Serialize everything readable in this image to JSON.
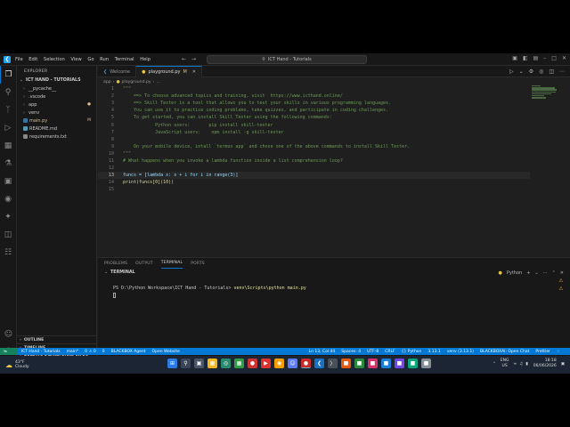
{
  "titlebar": {
    "menu": [
      "File",
      "Edit",
      "Selection",
      "View",
      "Go",
      "Run",
      "Terminal",
      "Help"
    ],
    "search_text": "ICT Hand - Tutorials"
  },
  "sidebar": {
    "header": "EXPLORER",
    "section": "ICT HAND - TUTORIALS",
    "items": [
      {
        "label": "__pycache__",
        "type": "folder",
        "badge": ""
      },
      {
        "label": ".vscode",
        "type": "folder",
        "badge": ""
      },
      {
        "label": "app",
        "type": "folder",
        "badge": "●"
      },
      {
        "label": "venv",
        "type": "folder",
        "badge": ""
      },
      {
        "label": "main.py",
        "type": "py",
        "badge": "M"
      },
      {
        "label": "README.md",
        "type": "md",
        "badge": ""
      },
      {
        "label": "requirements.txt",
        "type": "txt",
        "badge": ""
      }
    ],
    "outline": "OUTLINE",
    "timeline": "TIMELINE",
    "remote": "REMOTE KNOWLEDGE FILES"
  },
  "tabs": [
    {
      "label": "Welcome",
      "active": false,
      "modified": ""
    },
    {
      "label": "playground.py",
      "active": true,
      "modified": "M"
    }
  ],
  "breadcrumb": {
    "folder": "app",
    "file": "playground.py",
    "more": "..."
  },
  "editor": {
    "lines": [
      {
        "n": "1",
        "text": "\"\"\""
      },
      {
        "n": "2",
        "text": "    ==> To choose advanced topics and training, visit  https://www.icthand.online/"
      },
      {
        "n": "3",
        "text": "    ==> Skill Tester is a tool that allows you to test your skills in various programming languages."
      },
      {
        "n": "4",
        "text": "    You can use it to practice coding problems, take quizzes, and participate in coding challenges."
      },
      {
        "n": "5",
        "text": "    To get started, you can install Skill Tester using the following commands:"
      },
      {
        "n": "6",
        "text": "            Python users:       pip install skill-tester"
      },
      {
        "n": "7",
        "text": "            JavaScript users:    npm install -g skill-tester"
      },
      {
        "n": "8",
        "text": ""
      },
      {
        "n": "9",
        "text": "    On your mobile device, intall `termux app` and chose one of the above commands to install Skill Tester."
      },
      {
        "n": "10",
        "text": "\"\"\""
      },
      {
        "n": "11",
        "text": "# What happens when you invoke a lambda function inside a list comprehension loop?"
      },
      {
        "n": "12",
        "text": ""
      },
      {
        "n": "13",
        "text": "funcs = [lambda x: x + i for i in range(3)]"
      },
      {
        "n": "14",
        "text": "print(funcs[0](10))"
      },
      {
        "n": "15",
        "text": ""
      }
    ]
  },
  "panel": {
    "tabs": [
      "PROBLEMS",
      "OUTPUT",
      "TERMINAL",
      "PORTS"
    ],
    "active_tab": "TERMINAL",
    "terminal_header": "TERMINAL",
    "shell": "Python",
    "prompt": "PS D:\\Python Workspace\\ICT Hand - Tutorials> ",
    "command": "venv\\Scripts\\python main.py"
  },
  "statusbar": {
    "left": [
      "ICT Hand - Tutorials",
      "main*",
      "0 ⚠ 0",
      "0",
      "BLACKBOX Agent",
      "Open Website"
    ],
    "right": [
      "Ln 13, Col 44",
      "Spaces: 4",
      "UTF-8",
      "CRLF",
      "{} Python",
      "3.13.1",
      "venv (3.13.1)",
      "BLACKBOXAI: Open Chat",
      "Prettier"
    ]
  },
  "taskbar": {
    "weather_temp": "43°F",
    "weather_desc": "Cloudy",
    "lang": "ENG",
    "region": "US",
    "time": "18:18",
    "date": "06/06/2026"
  },
  "colors": {
    "accent": "#0078d4",
    "comment": "#6a9955",
    "keyword": "#569cd6"
  }
}
